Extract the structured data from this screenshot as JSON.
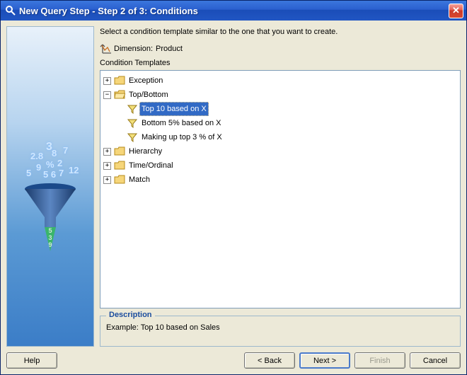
{
  "window": {
    "title": "New Query Step - Step 2 of 3: Conditions"
  },
  "instruction": "Select a condition template similar to the one that you want to create.",
  "dimension": {
    "label": "Dimension:",
    "value": "Product"
  },
  "section_label": "Condition Templates",
  "tree": {
    "exception": "Exception",
    "topbottom": {
      "label": "Top/Bottom",
      "items": [
        "Top 10 based on X",
        "Bottom 5% based on X",
        "Making up top 3 % of X"
      ]
    },
    "hierarchy": "Hierarchy",
    "timeordinal": "Time/Ordinal",
    "match": "Match"
  },
  "description": {
    "legend": "Description",
    "text": "Example: Top 10 based on Sales"
  },
  "buttons": {
    "help": "Help",
    "back": "< Back",
    "next": "Next >",
    "finish": "Finish",
    "cancel": "Cancel"
  }
}
